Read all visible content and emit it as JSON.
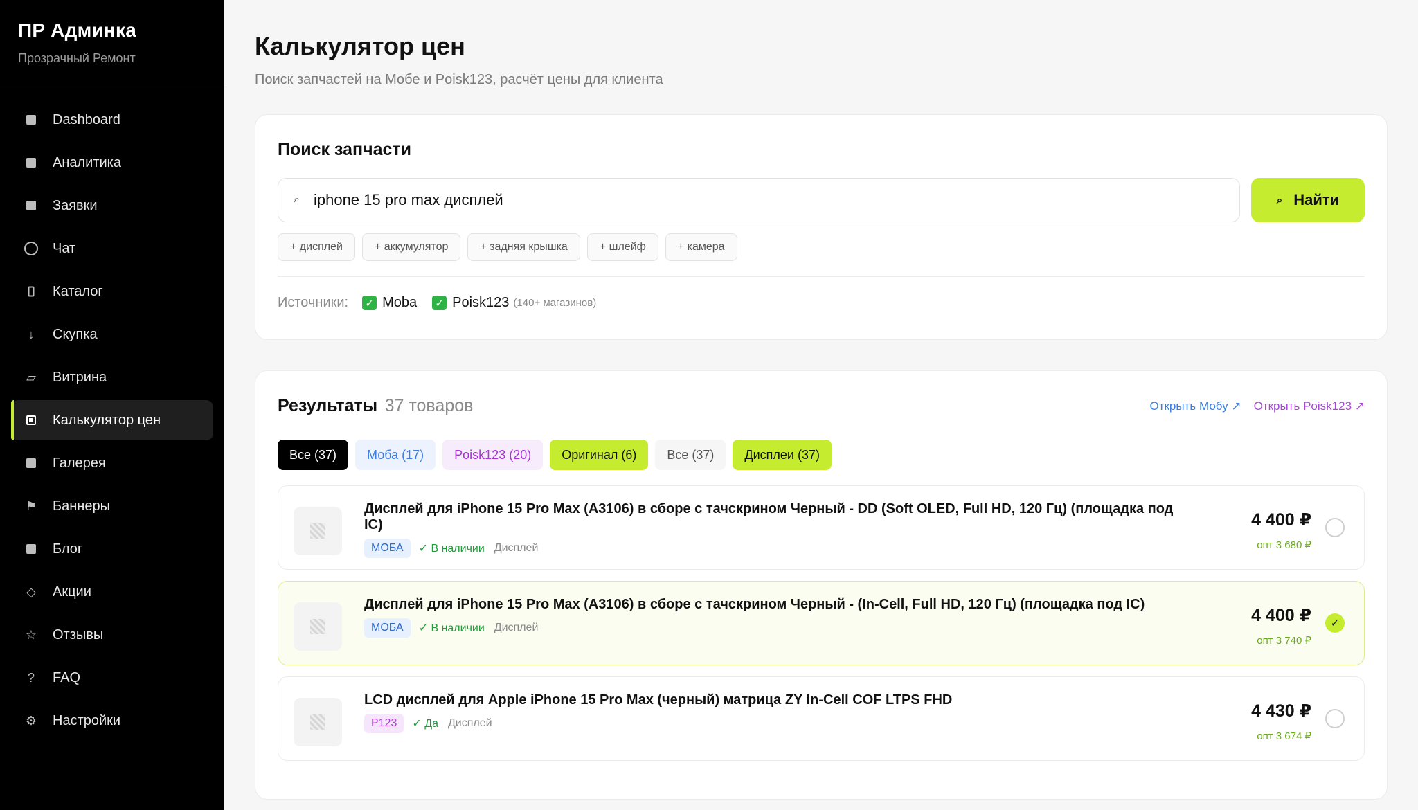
{
  "sidebar": {
    "title": "ПР Админка",
    "subtitle": "Прозрачный Ремонт",
    "items": [
      {
        "label": "Dashboard",
        "icon": "square-icon"
      },
      {
        "label": "Аналитика",
        "icon": "square-icon"
      },
      {
        "label": "Заявки",
        "icon": "square-icon"
      },
      {
        "label": "Чат",
        "icon": "circle-icon"
      },
      {
        "label": "Каталог",
        "icon": "phone-icon"
      },
      {
        "label": "Скупка",
        "icon": "arrow-down-icon"
      },
      {
        "label": "Витрина",
        "icon": "parallelogram-icon"
      },
      {
        "label": "Калькулятор цен",
        "icon": "square-icon",
        "active": true
      },
      {
        "label": "Галерея",
        "icon": "square-icon"
      },
      {
        "label": "Баннеры",
        "icon": "flag-icon"
      },
      {
        "label": "Блог",
        "icon": "square-icon"
      },
      {
        "label": "Акции",
        "icon": "diamond-icon"
      },
      {
        "label": "Отзывы",
        "icon": "star-icon"
      },
      {
        "label": "FAQ",
        "icon": "question-icon"
      },
      {
        "label": "Настройки",
        "icon": "gear-icon"
      }
    ]
  },
  "header": {
    "title": "Калькулятор цен",
    "subtitle": "Поиск запчастей на Мобе и Poisk123, расчёт цены для клиента"
  },
  "search": {
    "title": "Поиск запчасти",
    "value": "iphone 15 pro max дисплей",
    "button": "Найти",
    "chips": [
      "+ дисплей",
      "+ аккумулятор",
      "+ задняя крышка",
      "+ шлейф",
      "+ камера"
    ],
    "sources_label": "Источники:",
    "sources": [
      {
        "name": "Moba",
        "checked": true,
        "note": ""
      },
      {
        "name": "Poisk123",
        "checked": true,
        "note": "(140+ магазинов)"
      }
    ]
  },
  "results": {
    "title": "Результаты",
    "count": "37 товаров",
    "link_moba": "Открыть Мобу ↗",
    "link_poisk": "Открыть Poisk123 ↗",
    "filters": [
      {
        "label": "Все (37)",
        "style": "dark"
      },
      {
        "label": "Моба (17)",
        "style": "blue"
      },
      {
        "label": "Poisk123 (20)",
        "style": "purple"
      },
      {
        "label": "Оригинал (6)",
        "style": "lime"
      },
      {
        "label": "Все (37)",
        "style": "plain"
      },
      {
        "label": "Дисплеи (37)",
        "style": "lime"
      }
    ],
    "items": [
      {
        "name": "Дисплей для iPhone 15 Pro Max (A3106) в сборе с тачскрином Черный - DD (Soft OLED, Full HD, 120 Гц) (площадка под IC)",
        "source": "МОБА",
        "stock": "✓ В наличии",
        "category": "Дисплей",
        "price": "4 400 ₽",
        "opt": "опт 3 680 ₽",
        "selected": false
      },
      {
        "name": "Дисплей для iPhone 15 Pro Max (A3106) в сборе с тачскрином Черный - (In-Cell, Full HD, 120 Гц) (площадка под IC)",
        "source": "МОБА",
        "stock": "✓ В наличии",
        "category": "Дисплей",
        "price": "4 400 ₽",
        "opt": "опт 3 740 ₽",
        "selected": true
      },
      {
        "name": "LCD дисплей для Apple iPhone 15 Pro Max (черный) матрица ZY In-Cell COF LTPS FHD",
        "source": "P123",
        "stock": "✓ Да",
        "category": "Дисплей",
        "price": "4 430 ₽",
        "opt": "опт 3 674 ₽",
        "selected": false
      }
    ]
  },
  "colors": {
    "accent": "#c6ec2f",
    "sidebar_bg": "#000000",
    "moba_blue": "#3b7de0",
    "poisk_purple": "#a64ad6",
    "in_stock_green": "#1f9d3a"
  }
}
